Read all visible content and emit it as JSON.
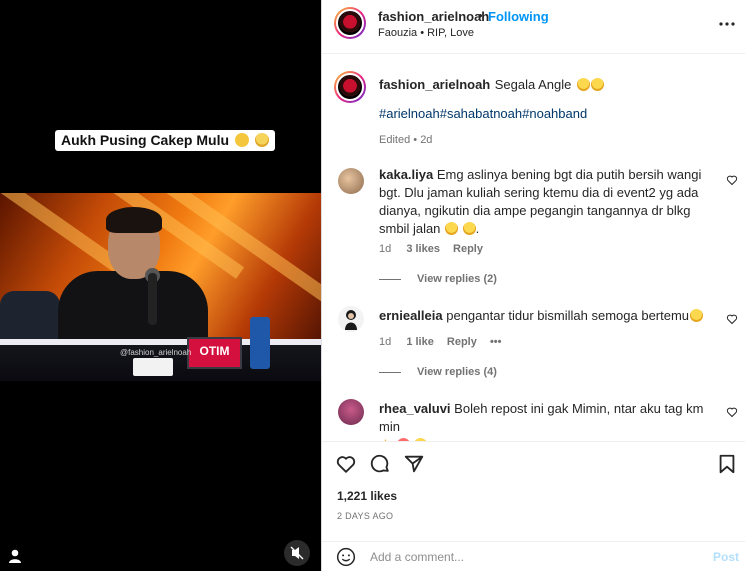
{
  "media": {
    "caption": "Aukh Pusing Cakep Mulu",
    "watermark": "@fashion_arielnoah",
    "tv_text": "OTIM",
    "icons": {
      "user": "user-icon",
      "mute": "mute-icon"
    }
  },
  "header": {
    "username": "fashion_arielnoah",
    "separator": "•",
    "follow_status": "Following",
    "subtitle": "Faouzia • RIP, Love"
  },
  "post": {
    "username": "fashion_arielnoah",
    "caption": "Segala Angle",
    "hashtags": "#arielnoah#sahabatnoah#noahband",
    "edited": "Edited",
    "age": "2d"
  },
  "comments": [
    {
      "username": "kaka.liya",
      "text": "Emg aslinya bening bgt dia putih bersih wangi bgt. Dlu jaman kuliah sering ktemu dia di event2 yg ada dianya, ngikutin dia ampe pegangin tangannya dr blkg smbil jalan",
      "age": "1d",
      "likes": "3 likes",
      "reply": "Reply",
      "view_replies": "View replies (2)"
    },
    {
      "username": "ernieallei a",
      "display_username": "erniealleia",
      "text": "pengantar tidur bismillah semoga bertemu",
      "age": "1d",
      "likes": "1 like",
      "reply": "Reply",
      "more": "•••",
      "view_replies": "View replies (4)"
    },
    {
      "username": "rhea_valuvi",
      "text": "Boleh repost ini gak Mimin, ntar aku tag km min"
    }
  ],
  "actions": {
    "likes": "1,221 likes",
    "date": "2 DAYS AGO"
  },
  "add_comment": {
    "placeholder": "Add a comment...",
    "post_label": "Post"
  },
  "colors": {
    "link": "#0095f6",
    "hashtag": "#00376b",
    "muted": "#737373",
    "post_disabled": "#b2dffc"
  }
}
